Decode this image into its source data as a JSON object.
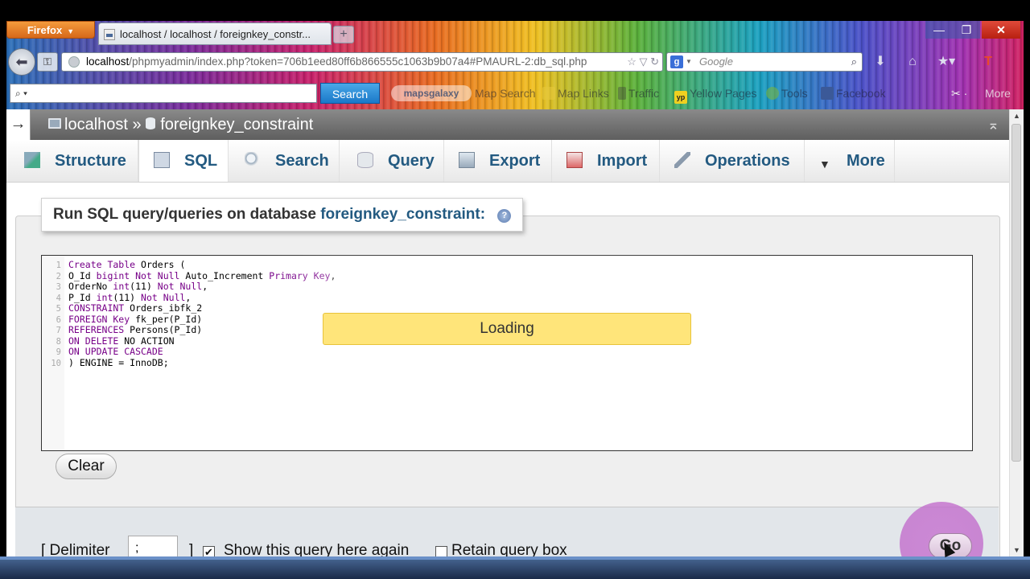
{
  "browser": {
    "menu_button": "Firefox",
    "tab_title": "localhost / localhost / foreignkey_constr...",
    "url_host": "localhost",
    "url_path": "/phpmyadmin/index.php?token=706b1eed80ff6b866555c1063b9b07a4#PMAURL-2:db_sql.php",
    "search_engine_placeholder": "Google",
    "toolbar_search_button": "Search",
    "toolbar_links": [
      "Map Search",
      "Map Links",
      "Traffic",
      "Yellow Pages",
      "Tools",
      "Facebook"
    ],
    "logo_text": "mapsgalaxy",
    "more_label": "More"
  },
  "breadcrumb": {
    "server": "localhost",
    "separator": "»",
    "database": "foreignkey_constraint"
  },
  "tabs": [
    {
      "label": "Structure"
    },
    {
      "label": "SQL"
    },
    {
      "label": "Search"
    },
    {
      "label": "Query"
    },
    {
      "label": "Export"
    },
    {
      "label": "Import"
    },
    {
      "label": "Operations"
    },
    {
      "label": "More"
    }
  ],
  "sql_panel": {
    "legend_prefix": "Run SQL query/queries on database",
    "legend_db": "foreignkey_constraint:",
    "help_icon": "?",
    "loading_text": "Loading",
    "clear_button": "Clear",
    "delimiter_label": "[ Delimiter",
    "delimiter_value": ";",
    "delimiter_close": "]",
    "show_query_label": "Show this query here again",
    "show_query_checked": true,
    "retain_query_label": "Retain query box",
    "retain_query_checked": false,
    "go_button": "Go"
  },
  "code_lines": [
    {
      "n": "1",
      "parts": [
        {
          "k": "kw",
          "t": "Create Table"
        },
        {
          "k": "tx",
          "t": " Orders ("
        }
      ]
    },
    {
      "n": "2",
      "parts": [
        {
          "k": "tx",
          "t": "O_Id "
        },
        {
          "k": "kw",
          "t": "bigint Not Null"
        },
        {
          "k": "tx",
          "t": " Auto_Increment "
        },
        {
          "k": "kw",
          "t": "Primary Key"
        },
        {
          "k": "tx",
          "t": ","
        }
      ]
    },
    {
      "n": "3",
      "parts": [
        {
          "k": "tx",
          "t": "OrderNo "
        },
        {
          "k": "kw",
          "t": "int"
        },
        {
          "k": "tx",
          "t": "(11) "
        },
        {
          "k": "kw",
          "t": "Not Null"
        },
        {
          "k": "tx",
          "t": ","
        }
      ]
    },
    {
      "n": "4",
      "parts": [
        {
          "k": "tx",
          "t": "P_Id "
        },
        {
          "k": "kw",
          "t": "int"
        },
        {
          "k": "tx",
          "t": "(11) "
        },
        {
          "k": "kw",
          "t": "Not Null"
        },
        {
          "k": "tx",
          "t": ","
        }
      ]
    },
    {
      "n": "5",
      "parts": [
        {
          "k": "kw",
          "t": "CONSTRAINT"
        },
        {
          "k": "tx",
          "t": " Orders_ibfk_2"
        }
      ]
    },
    {
      "n": "6",
      "parts": [
        {
          "k": "kw",
          "t": "FOREIGN Key"
        },
        {
          "k": "tx",
          "t": " fk_per(P_Id)"
        }
      ]
    },
    {
      "n": "7",
      "parts": [
        {
          "k": "kw",
          "t": "REFERENCES"
        },
        {
          "k": "tx",
          "t": " Persons(P_Id)"
        }
      ]
    },
    {
      "n": "8",
      "parts": [
        {
          "k": "kw",
          "t": "ON DELETE"
        },
        {
          "k": "tx",
          "t": " NO ACTION"
        }
      ]
    },
    {
      "n": "9",
      "parts": [
        {
          "k": "kw",
          "t": "ON UPDATE CASCADE"
        }
      ]
    },
    {
      "n": "10",
      "parts": [
        {
          "k": "tx",
          "t": ") ENGINE = InnoDB;"
        }
      ]
    }
  ],
  "colors": {
    "link_blue": "#235a81",
    "keyword_purple": "#770088",
    "loading_yellow": "#ffe57a"
  }
}
